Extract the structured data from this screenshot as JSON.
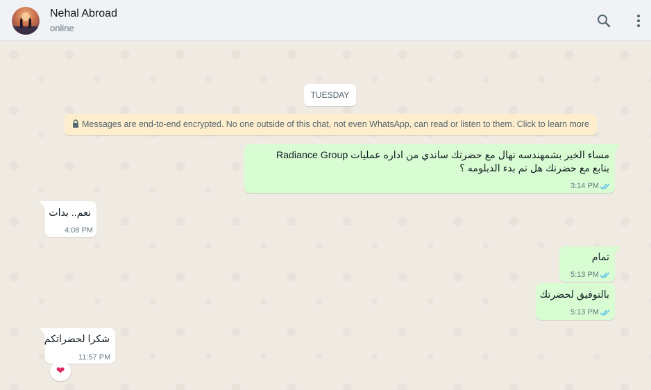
{
  "header": {
    "contact_name": "Nehal Abroad",
    "status": "online",
    "icons": [
      "search-icon",
      "menu-icon"
    ]
  },
  "chat": {
    "date_chip": "TUESDAY",
    "encryption_notice": "Messages are end-to-end encrypted. No one outside of this chat, not even WhatsApp, can read or listen to them. Click to learn more",
    "messages": [
      {
        "direction": "outgoing",
        "lines": [
          "مساء الخير بشمهندسه نهال مع حضرتك ساندي من اداره عمليات Radiance Group",
          "بتابع مع حضرتك هل تم بدء الدبلومه ؟"
        ],
        "time": "3:14 PM",
        "status": "read"
      },
      {
        "direction": "incoming",
        "lines": [
          "نعم.. بدات"
        ],
        "time": "4:08 PM"
      },
      {
        "direction": "outgoing",
        "lines": [
          "تمام"
        ],
        "time": "5:13 PM",
        "status": "read"
      },
      {
        "direction": "outgoing",
        "lines": [
          "بالتوفيق لحضرتك"
        ],
        "time": "5:13 PM",
        "status": "read"
      },
      {
        "direction": "incoming",
        "lines": [
          "شكرا لحضراتكم"
        ],
        "time": "11:57 PM",
        "reaction": "❤"
      }
    ]
  },
  "colors": {
    "outgoing_bubble": "#d9fdd3",
    "incoming_bubble": "#ffffff",
    "read_ticks": "#53bdeb",
    "chat_background": "#efeae2"
  }
}
